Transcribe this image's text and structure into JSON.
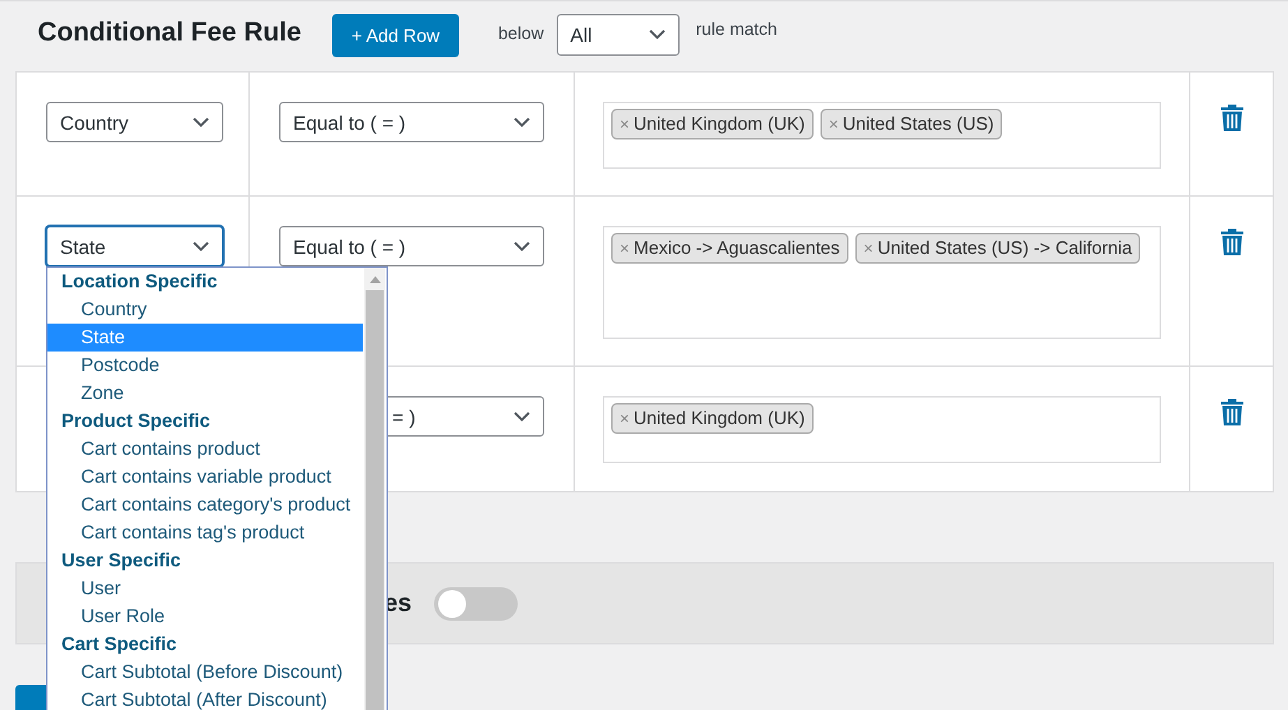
{
  "header": {
    "title": "Conditional Fee Rule",
    "add_button": "+ Add Row",
    "below_label": "below",
    "match_select": "All",
    "match_label": "rule match"
  },
  "rules": [
    {
      "condition": "Country",
      "focused": false,
      "operator": "Equal to ( = )",
      "operator_covered": false,
      "values": [
        {
          "remove": "×",
          "label": "United Kingdom (UK)"
        },
        {
          "remove": "×",
          "label": "United States (US)"
        }
      ]
    },
    {
      "condition": "State",
      "focused": true,
      "operator": "Equal to ( = )",
      "operator_covered": false,
      "values": [
        {
          "remove": "×",
          "label": "Mexico -> Aguascalientes"
        },
        {
          "remove": "×",
          "label": "United States (US) -> California"
        }
      ]
    },
    {
      "operator": "= )",
      "operator_covered": true,
      "values": [
        {
          "remove": "×",
          "label": "United Kingdom (UK)"
        }
      ]
    }
  ],
  "dropdown": {
    "groups": [
      {
        "label": "Location Specific",
        "options": [
          {
            "label": "Country",
            "selected": false
          },
          {
            "label": "State",
            "selected": true
          },
          {
            "label": "Postcode",
            "selected": false
          },
          {
            "label": "Zone",
            "selected": false
          }
        ]
      },
      {
        "label": "Product Specific",
        "options": [
          {
            "label": "Cart contains product",
            "selected": false
          },
          {
            "label": "Cart contains variable product",
            "selected": false
          },
          {
            "label": "Cart contains category's product",
            "selected": false
          },
          {
            "label": "Cart contains tag's product",
            "selected": false
          }
        ]
      },
      {
        "label": "User Specific",
        "options": [
          {
            "label": "User",
            "selected": false
          },
          {
            "label": "User Role",
            "selected": false
          }
        ]
      },
      {
        "label": "Cart Specific",
        "options": [
          {
            "label": "Cart Subtotal (Before Discount)",
            "selected": false
          },
          {
            "label": "Cart Subtotal (After Discount)",
            "selected": false
          }
        ]
      }
    ]
  },
  "section": {
    "label": "es",
    "toggle_on": false
  }
}
